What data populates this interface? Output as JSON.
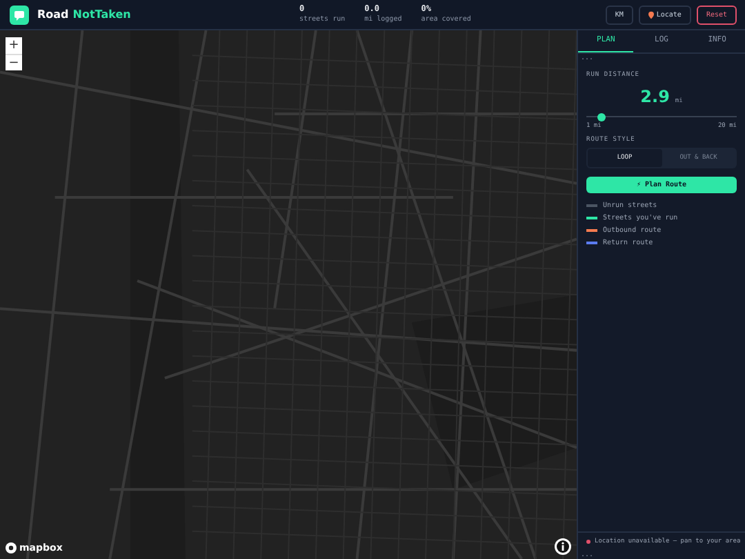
{
  "header": {
    "logo_text": "Road",
    "logo_accent": "NotTaken",
    "stats": [
      {
        "value": "0",
        "label": "streets run"
      },
      {
        "value": "0.0",
        "label": "mi logged"
      },
      {
        "value": "0%",
        "label": "area covered"
      }
    ],
    "buttons": [
      {
        "label": "KM",
        "kind": "plain"
      },
      {
        "label": "Locate",
        "kind": "pin"
      },
      {
        "label": "Reset",
        "kind": "danger"
      }
    ]
  },
  "map": {
    "zoom_in": "+",
    "zoom_out": "−",
    "attribution": "mapbox"
  },
  "sidebar": {
    "tabs": [
      {
        "label": "PLAN",
        "selected": true
      },
      {
        "label": "LOG",
        "selected": false
      },
      {
        "label": "INFO",
        "selected": false
      }
    ],
    "top_dots": "...",
    "run_distance": {
      "label": "RUN DISTANCE",
      "value": "2.9",
      "unit": "mi",
      "level": 0.1,
      "min": "1 mi",
      "max": "20 mi"
    },
    "route_style": {
      "label": "ROUTE STYLE",
      "options": [
        {
          "label": "LOOP",
          "selected": true
        },
        {
          "label": "OUT & BACK",
          "selected": false
        }
      ]
    },
    "plan_button": "⚡ Plan Route",
    "legend": [
      {
        "label": "Unrun streets",
        "color": "#4b5563"
      },
      {
        "label": "Streets you've run",
        "color": "#2ee6a6"
      },
      {
        "label": "Outbound route",
        "color": "#f47a50"
      },
      {
        "label": "Return route",
        "color": "#5b7cf0"
      }
    ],
    "status": "Location unavailable — pan to your area",
    "bottom_dots": "..."
  }
}
